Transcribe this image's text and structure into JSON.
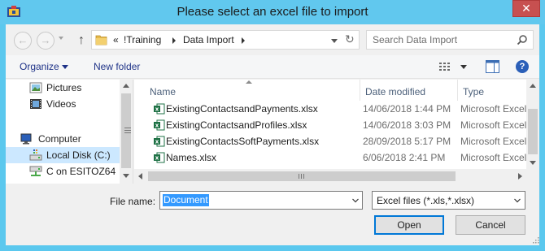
{
  "window": {
    "title": "Please select an excel file to import",
    "close_glyph": "✕"
  },
  "address_bar": {
    "overflow": "«",
    "crumbs": [
      "!Training",
      "Data Import"
    ]
  },
  "search": {
    "placeholder": "Search Data Import"
  },
  "toolbar": {
    "organize_label": "Organize",
    "new_folder_label": "New folder",
    "help_glyph": "?"
  },
  "nav_pane": {
    "items": [
      {
        "label": "Pictures",
        "icon": "pictures-icon",
        "selected": false
      },
      {
        "label": "Videos",
        "icon": "videos-icon",
        "selected": false
      },
      {
        "label": "Computer",
        "icon": "computer-icon",
        "selected": false
      },
      {
        "label": "Local Disk (C:)",
        "icon": "local-disk-icon",
        "selected": true
      },
      {
        "label": "C on ESITOZ64",
        "icon": "network-drive-icon",
        "selected": false
      }
    ]
  },
  "file_list": {
    "columns": [
      "Name",
      "Date modified",
      "Type"
    ],
    "rows": [
      {
        "name": "ExistingContactsandPayments.xlsx",
        "date": "14/06/2018 1:44 PM",
        "type": "Microsoft Excel W"
      },
      {
        "name": "ExistingContactsandProfiles.xlsx",
        "date": "14/06/2018 3:03 PM",
        "type": "Microsoft Excel W"
      },
      {
        "name": "ExistingContactsSoftPayments.xlsx",
        "date": "28/09/2018 5:17 PM",
        "type": "Microsoft Excel W"
      },
      {
        "name": "Names.xlsx",
        "date": "6/06/2018 2:41 PM",
        "type": "Microsoft Excel W"
      }
    ]
  },
  "file_name": {
    "label": "File name:",
    "value": "Document"
  },
  "file_type": {
    "value": "Excel files (*.xls,*.xlsx)"
  },
  "buttons": {
    "open": "Open",
    "cancel": "Cancel"
  },
  "colors": {
    "title_bar": "#61c8ee",
    "selection": "#cce8ff",
    "text_selection": "#3399ff",
    "link_text": "#1e3287",
    "close_button": "#c75050"
  }
}
